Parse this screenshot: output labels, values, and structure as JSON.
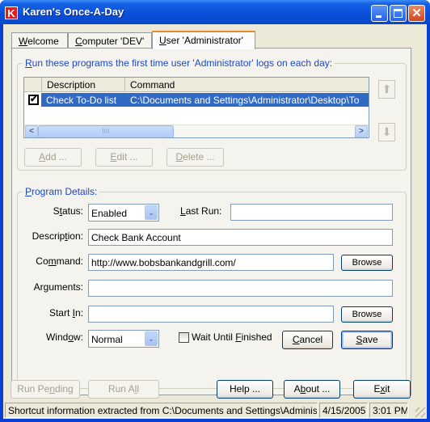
{
  "window": {
    "title": "Karen's Once-A-Day",
    "app_icon_letter": "K",
    "controls": {
      "minimize": "minimize",
      "maximize": "maximize",
      "close": "✕"
    }
  },
  "tabs": [
    {
      "label": "Welcome",
      "mnemonic": "W",
      "rest": "elcome",
      "active": false
    },
    {
      "label": "Computer 'DEV'",
      "mnemonic": "C",
      "rest": "omputer 'DEV'",
      "active": false
    },
    {
      "label": "User 'Administrator'",
      "mnemonic": "U",
      "rest": "ser 'Administrator'",
      "active": true
    }
  ],
  "programs_group": {
    "title_mnemonic": "R",
    "title_rest": "un these programs the first time user 'Administrator' logs on each day:",
    "columns": [
      "Description",
      "Command"
    ],
    "rows": [
      {
        "checked": true,
        "check_glyph": "✔",
        "description": "Check To-Do list",
        "command": "C:\\Documents and Settings\\Administrator\\Desktop\\To"
      }
    ],
    "scroll": {
      "left": "<",
      "right": ">",
      "thumb": "IIII"
    },
    "move_up": "⬆",
    "move_down": "⬇",
    "buttons": {
      "add": {
        "m": "A",
        "rest": "dd ..."
      },
      "edit": {
        "m": "E",
        "rest": "dit ..."
      },
      "delete": {
        "m": "D",
        "rest": "elete ..."
      }
    }
  },
  "details_group": {
    "title_mnemonic": "P",
    "title_rest": "rogram Details:",
    "status": {
      "pre": "S",
      "m": "t",
      "post": "atus:",
      "value": "Enabled"
    },
    "last_run": {
      "pre": "",
      "m": "L",
      "post": "ast Run:",
      "value": ""
    },
    "description": {
      "pre": "Descrip",
      "m": "t",
      "post": "ion:",
      "value": "Check Bank Account"
    },
    "command": {
      "pre": "Co",
      "m": "m",
      "post": "mand:",
      "value": "http://www.bobsbankandgrill.com/"
    },
    "arguments": {
      "pre": "Ar",
      "m": "g",
      "post": "uments:",
      "value": ""
    },
    "start_in": {
      "pre": "Start ",
      "m": "I",
      "post": "n:",
      "value": ""
    },
    "window": {
      "pre": "Wind",
      "m": "o",
      "post": "w:",
      "value": "Normal"
    },
    "wait_until_finished": {
      "pre": "Wait Until ",
      "m": "F",
      "post": "inished",
      "checked": false
    },
    "browse_label": "Browse",
    "cancel": {
      "m": "C",
      "rest": "ancel"
    },
    "save": {
      "m": "S",
      "rest": "ave"
    },
    "combo_arrow": "⌄"
  },
  "bottom_buttons": {
    "run_pending": {
      "pre": "Run Pe",
      "m": "n",
      "post": "ding"
    },
    "run_all": {
      "pre": "Run A",
      "m": "l",
      "post": "l"
    },
    "help": "Help ...",
    "about": {
      "pre": "A",
      "m": "b",
      "post": "out ..."
    },
    "exit": {
      "pre": "E",
      "m": "x",
      "post": "it"
    }
  },
  "statusbar": {
    "message": "Shortcut information extracted from C:\\Documents and Settings\\Administrator",
    "date": "4/15/2005",
    "time": "3:01 PM"
  }
}
